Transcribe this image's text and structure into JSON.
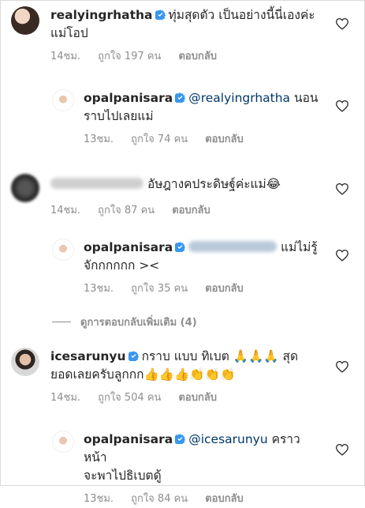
{
  "comments": [
    {
      "username": "realyingrhatha",
      "text_line1": "ทุ่มสุดตัว เป็นอย่างนี้นี่เองค่ะ",
      "text_line2": "แม่โอป",
      "time": "14ชม.",
      "likes": "ถูกใจ 197 คน",
      "reply": "ตอบกลับ"
    },
    {
      "username": "opalpanisara",
      "mention": "@realyingrhatha",
      "text_after": " นอน",
      "text_line2": "ราบไปเลยแม่",
      "time": "13ชม.",
      "likes": "ถูกใจ 74 คน",
      "reply": "ตอบกลับ"
    },
    {
      "text_line1": "อัษฎางคประดิษฐ์ค่ะแม่😂",
      "time": "14ชม.",
      "likes": "ถูกใจ 87 คน",
      "reply": "ตอบกลับ"
    },
    {
      "username": "opalpanisara",
      "text_after": " แม่ไม่รู้",
      "text_line2": "จักกกกกก ><",
      "time": "13ชม.",
      "likes": "ถูกใจ 35 คน",
      "reply": "ตอบกลับ"
    },
    {
      "username": "icesarunyu",
      "text_line1": "กราบ แบบ ทิเบต 🙏🙏🙏 สุด",
      "text_line2": "ยอดเลยครับลูกกก👍👍👍👏👏👏",
      "time": "14ชม.",
      "likes": "ถูกใจ 504 คน",
      "reply": "ตอบกลับ"
    },
    {
      "username": "opalpanisara",
      "mention": "@icesarunyu",
      "text_after": " คราวหน้า",
      "text_line2": "จะพาไปธิเบตดู้",
      "time": "13ชม.",
      "likes": "ถูกใจ 84 คน",
      "reply": "ตอบกลับ"
    }
  ],
  "view_more_replies": "ดูการตอบกลับเพิ่มเติม (4)",
  "colors": {
    "verified": "#3897f0",
    "mention": "#00376b",
    "meta": "#8e8e8e"
  },
  "icons": {
    "like": "heart-icon",
    "verified": "verified-badge-icon"
  }
}
